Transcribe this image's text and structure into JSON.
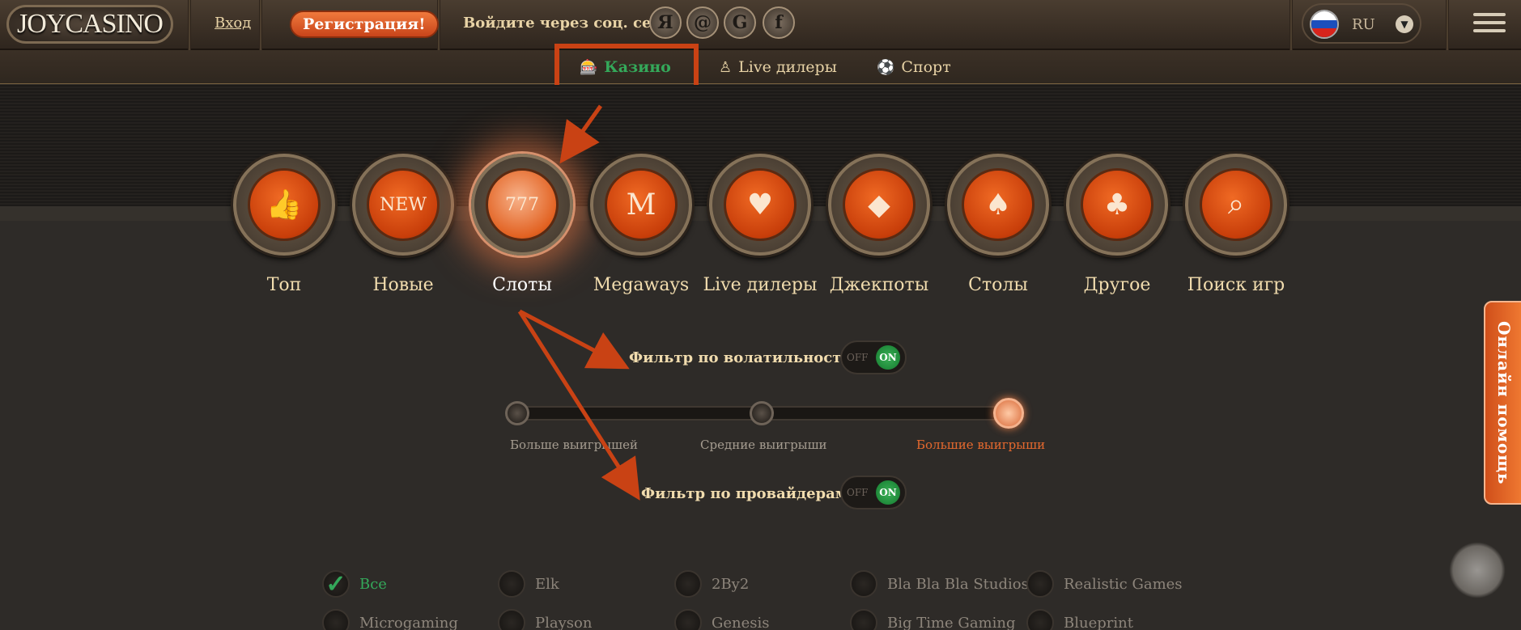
{
  "header": {
    "logo": "JOYCASINO",
    "login": "Вход",
    "register": "Регистрация!",
    "social_label": "Войдите через соц. сети:",
    "socials": [
      "Я",
      "@",
      "G",
      "f"
    ],
    "language": "RU"
  },
  "subnav": {
    "casino": "Казино",
    "live": "Live дилеры",
    "sport": "Спорт"
  },
  "categories": [
    {
      "label": "Топ",
      "icon": "thumbs-up-icon",
      "glyph": "👍"
    },
    {
      "label": "Новые",
      "icon": "new-badge-icon",
      "glyph": "NEW"
    },
    {
      "label": "Слоты",
      "icon": "slot-machine-icon",
      "glyph": "777",
      "active": true
    },
    {
      "label": "Megaways",
      "icon": "megaways-icon",
      "glyph": "M"
    },
    {
      "label": "Live дилеры",
      "icon": "live-dealer-icon",
      "glyph": "♥"
    },
    {
      "label": "Джекпоты",
      "icon": "diamond-icon",
      "glyph": "◆"
    },
    {
      "label": "Столы",
      "icon": "cards-icon",
      "glyph": "♠"
    },
    {
      "label": "Другое",
      "icon": "bag-icon",
      "glyph": "♣"
    },
    {
      "label": "Поиск игр",
      "icon": "search-icon",
      "glyph": "⌕"
    }
  ],
  "filters": {
    "volatility_label": "Фильтр по волатильности:",
    "volatility_toggle": {
      "off": "OFF",
      "on": "ON"
    },
    "provider_label": "Фильтр по провайдерам:",
    "provider_toggle": {
      "off": "OFF",
      "on": "ON"
    },
    "slider_labels": [
      "Больше выигрышей",
      "Средние выигрыши",
      "Большие выигрыши"
    ],
    "slider_selected": 2
  },
  "providers": [
    {
      "label": "Все",
      "checked": true
    },
    {
      "label": "Elk"
    },
    {
      "label": "2By2"
    },
    {
      "label": "Bla Bla Bla Studios"
    },
    {
      "label": "Realistic Games"
    },
    {
      "label": "Microgaming"
    },
    {
      "label": "Playson"
    },
    {
      "label": "Genesis"
    },
    {
      "label": "Big Time Gaming"
    },
    {
      "label": "Blueprint"
    }
  ],
  "help": "Онлайн помощь",
  "colors": {
    "accent": "#e8622a",
    "active_green": "#34a85a",
    "highlight": "#c94214"
  }
}
